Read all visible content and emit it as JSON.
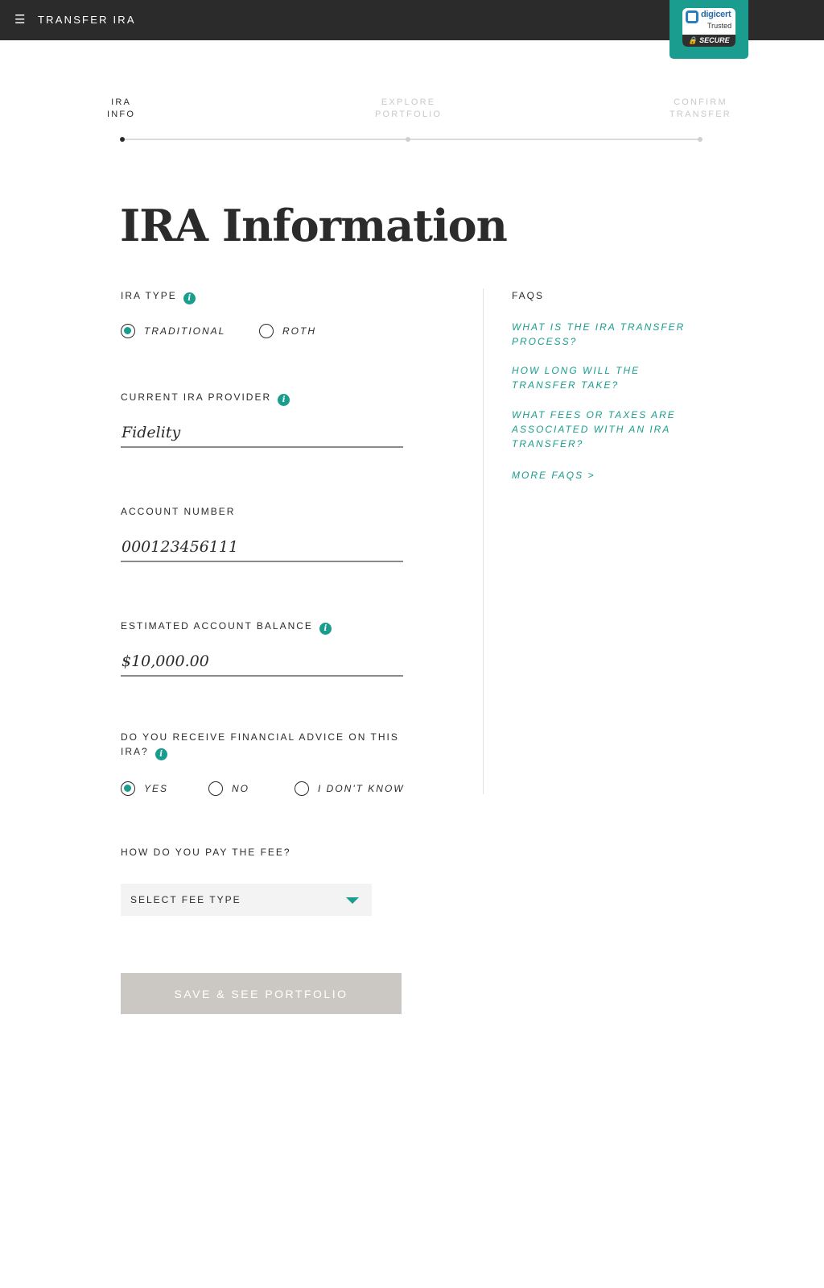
{
  "header": {
    "menu_icon": "hamburger-icon",
    "title": "TRANSFER IRA",
    "badge": {
      "brand": "digicert",
      "trusted": "Trusted",
      "secure": "SECURE"
    }
  },
  "steps": [
    {
      "label": "IRA\nINFO",
      "active": true
    },
    {
      "label": "EXPLORE\nPORTFOLIO",
      "active": false
    },
    {
      "label": "CONFIRM\nTRANSFER",
      "active": false
    }
  ],
  "page_title": "IRA Information",
  "form": {
    "ira_type": {
      "label": "IRA TYPE",
      "options": [
        "TRADITIONAL",
        "ROTH"
      ],
      "selected": "TRADITIONAL"
    },
    "provider": {
      "label": "CURRENT IRA PROVIDER",
      "value": "Fidelity"
    },
    "account_number": {
      "label": "ACCOUNT NUMBER",
      "value": "000123456111"
    },
    "balance": {
      "label": "ESTIMATED ACCOUNT BALANCE",
      "value": "$10,000.00"
    },
    "advice": {
      "label": "DO YOU RECEIVE FINANCIAL ADVICE ON THIS IRA?",
      "options": [
        "YES",
        "NO",
        "I DON'T KNOW"
      ],
      "selected": "YES"
    },
    "fee": {
      "label": "HOW DO YOU PAY THE FEE?",
      "select_value": "SELECT FEE TYPE"
    },
    "save_label": "SAVE & SEE PORTFOLIO"
  },
  "faqs": {
    "heading": "FAQS",
    "links": [
      "WHAT IS THE IRA TRANSFER PROCESS?",
      "HOW LONG WILL THE TRANSFER TAKE?",
      "WHAT FEES OR TAXES ARE ASSOCIATED WITH AN IRA TRANSFER?",
      "MORE FAQS >"
    ]
  },
  "colors": {
    "accent": "#1a9c8e",
    "header_bg": "#2b2b2b",
    "button_disabled": "#cbc7c3"
  }
}
